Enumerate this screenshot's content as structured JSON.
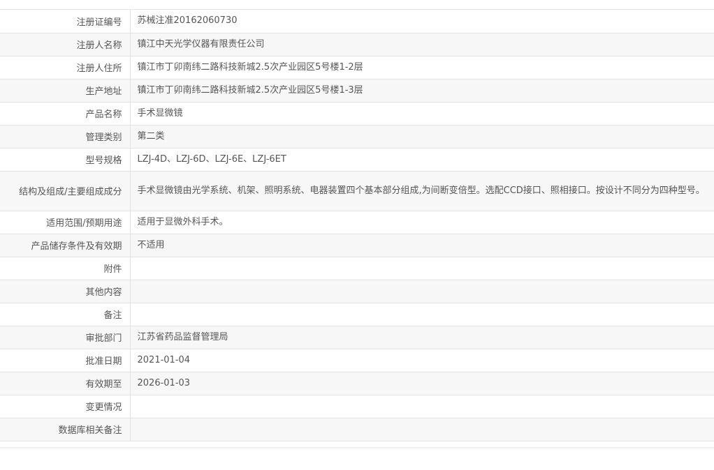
{
  "rows": [
    {
      "label": "注册证编号",
      "value": "苏械注准20162060730"
    },
    {
      "label": "注册人名称",
      "value": "镇江中天光学仪器有限责任公司"
    },
    {
      "label": "注册人住所",
      "value": "镇江市丁卯南纬二路科技新城2.5次产业园区5号楼1-2层"
    },
    {
      "label": "生产地址",
      "value": "镇江市丁卯南纬二路科技新城2.5次产业园区5号楼1-3层"
    },
    {
      "label": "产品名称",
      "value": "手术显微镜"
    },
    {
      "label": "管理类别",
      "value": "第二类"
    },
    {
      "label": "型号规格",
      "value": "LZJ-4D、LZJ-6D、LZJ-6E、LZJ-6ET"
    },
    {
      "label": "结构及组成/主要组成成分",
      "value": "手术显微镜由光学系统、机架、照明系统、电器装置四个基本部分组成,为间断变倍型。选配CCD接口、照相接口。按设计不同分为四种型号。"
    },
    {
      "label": "适用范围/预期用途",
      "value": "适用于显微外科手术。"
    },
    {
      "label": "产品储存条件及有效期",
      "value": "不适用"
    },
    {
      "label": "附件",
      "value": ""
    },
    {
      "label": "其他内容",
      "value": ""
    },
    {
      "label": "备注",
      "value": ""
    },
    {
      "label": "审批部门",
      "value": "江苏省药品监督管理局"
    },
    {
      "label": "批准日期",
      "value": "2021-01-04"
    },
    {
      "label": "有效期至",
      "value": "2026-01-03"
    },
    {
      "label": "变更情况",
      "value": ""
    },
    {
      "label": "数据库相关备注",
      "value": ""
    }
  ]
}
